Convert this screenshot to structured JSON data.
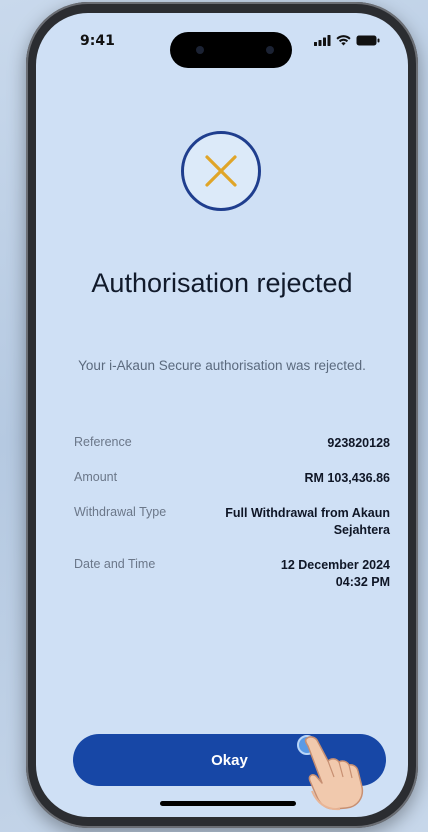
{
  "status_bar": {
    "time": "9:41"
  },
  "result": {
    "icon": "close-x-icon",
    "icon_color": "#e0a528",
    "ring_color": "#1f3e8e",
    "title": "Authorisation rejected",
    "message": "Your i-Akaun Secure authorisation was rejected."
  },
  "details": [
    {
      "label": "Reference",
      "value": "923820128"
    },
    {
      "label": "Amount",
      "value": "RM 103,436.86"
    },
    {
      "label": "Withdrawal Type",
      "value": "Full Withdrawal from Akaun Sejahtera"
    },
    {
      "label": "Date and Time",
      "value": "12 December 2024 04:32 PM"
    }
  ],
  "actions": {
    "okay_label": "Okay",
    "button_color": "#1747a6"
  }
}
